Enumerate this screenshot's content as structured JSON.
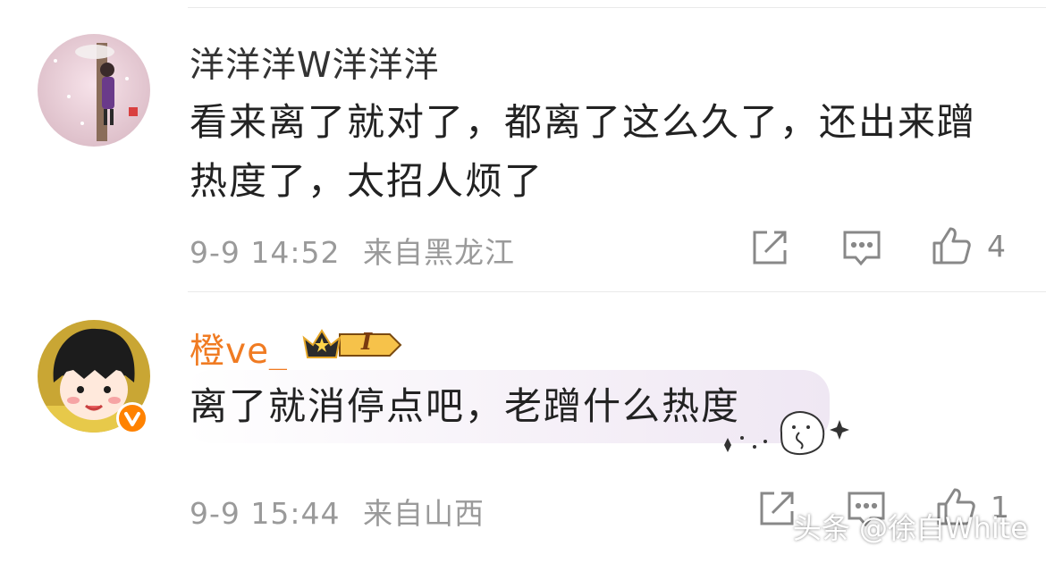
{
  "comments": [
    {
      "username": "洋洋洋W洋洋洋",
      "text": "看来离了就对了，都离了这么久了，还出来蹭热度了，太招人烦了",
      "timestamp": "9-9 14:52",
      "location": "来自黑龙江",
      "like_count": "4"
    },
    {
      "username": "橙ve_",
      "level_badge": "I",
      "text": "离了就消停点吧，老蹭什么热度",
      "timestamp": "9-9 15:44",
      "location": "来自山西",
      "like_count": "1"
    }
  ],
  "watermark": "头条 @徐白White",
  "colors": {
    "username_vip": "#f07b22",
    "text": "#222222",
    "meta": "#9a9a9a",
    "verified": "#ff8200"
  },
  "icons": [
    "share-icon",
    "reply-icon",
    "like-icon",
    "crown-icon",
    "verified-icon",
    "sticker-bear-icon"
  ]
}
